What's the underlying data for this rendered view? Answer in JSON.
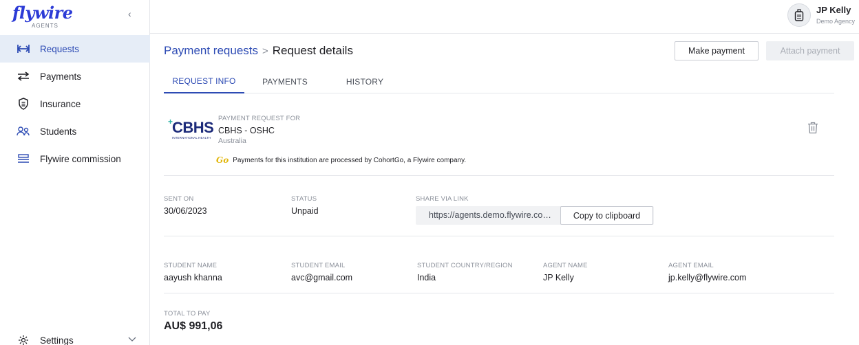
{
  "app": {
    "logo_text": "flywire",
    "logo_sub": "AGENTS"
  },
  "sidebar": {
    "items": [
      {
        "label": "Requests",
        "icon": "requests-icon",
        "active": true
      },
      {
        "label": "Payments",
        "icon": "payments-icon",
        "active": false
      },
      {
        "label": "Insurance",
        "icon": "insurance-shield-icon",
        "active": false
      },
      {
        "label": "Students",
        "icon": "students-icon",
        "active": false
      },
      {
        "label": "Flywire commission",
        "icon": "commission-icon",
        "active": false
      }
    ],
    "settings_label": "Settings"
  },
  "user": {
    "name": "JP Kelly",
    "org": "Demo Agency"
  },
  "header": {
    "breadcrumb_parent": "Payment requests",
    "breadcrumb_sep": ">",
    "breadcrumb_current": "Request details",
    "make_payment_label": "Make payment",
    "attach_payment_label": "Attach payment"
  },
  "tabs": [
    {
      "label": "REQUEST INFO",
      "active": true
    },
    {
      "label": "PAYMENTS",
      "active": false
    },
    {
      "label": "HISTORY",
      "active": false
    }
  ],
  "institution": {
    "logo_text": "CBHS",
    "logo_subtext": "INTERNATIONAL HEALTH",
    "for_label": "PAYMENT REQUEST FOR",
    "name": "CBHS - OSHC",
    "country": "Australia",
    "note_brand": "Go",
    "note": "Payments for this institution are processed by CohortGo, a Flywire company."
  },
  "request": {
    "sent_on_label": "SENT ON",
    "sent_on": "30/06/2023",
    "status_label": "STATUS",
    "status": "Unpaid",
    "share_label": "SHARE VIA LINK",
    "share_link": "https://agents.demo.flywire.com/re...",
    "copy_label": "Copy to clipboard"
  },
  "student": {
    "name_label": "STUDENT NAME",
    "name": "aayush khanna",
    "email_label": "STUDENT EMAIL",
    "email": "avc@gmail.com",
    "country_label": "STUDENT COUNTRY/REGION",
    "country": "India",
    "agent_name_label": "AGENT NAME",
    "agent_name": "JP Kelly",
    "agent_email_label": "AGENT EMAIL",
    "agent_email": "jp.kelly@flywire.com"
  },
  "total": {
    "label": "TOTAL TO PAY",
    "amount": "AU$ 991,06"
  },
  "colors": {
    "brand_blue": "#2d4bb4",
    "active_bg": "#e6edf7",
    "go_yellow": "#e2b70c"
  }
}
